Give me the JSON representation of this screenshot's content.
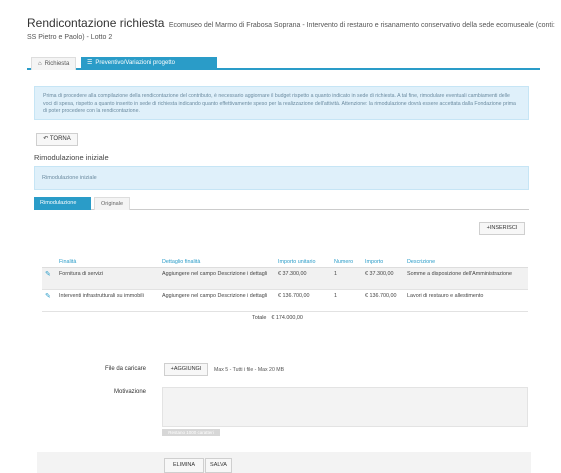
{
  "header": {
    "title": "Rendicontazione richiesta",
    "subtitle": "Ecomuseo del Marmo di Frabosa Soprana - Intervento di restauro e risanamento conservativo della sede ecomuseale (conti:",
    "subtitle_line2": "SS Pietro e Paolo) - Lotto 2"
  },
  "tabs": [
    {
      "label": "Richiesta",
      "icon": "home-icon"
    },
    {
      "label": "Preventivo/Variazioni progetto",
      "icon": "list-icon"
    }
  ],
  "info_text": "Prima di procedere alla compilazione della rendicontazione del contributo, è necessario aggiornare il budget rispetto a quanto indicato in sede di richiesta. A tal fine, rimodulare eventuali cambiamenti delle voci di spesa, rispetto a quanto inserito in sede di richiesta indicando quanto effettivamente speso per la realizzazione dell'attività. Attenzione: la rimodulazione dovrà essere accettata dalla Fondazione prima di poter procedere con la rendicontazione.",
  "back_button": "TORNA",
  "section_title": "Rimodulazione iniziale",
  "panel_text": "Rimodulazione iniziale",
  "subtabs": [
    "Rimodulazione",
    "Originale"
  ],
  "insert_button": "INSERISCI",
  "table": {
    "headers": [
      "Finalità",
      "Dettaglio finalità",
      "Importo unitario",
      "Numero",
      "Importo",
      "Descrizione"
    ],
    "rows": [
      {
        "finalita": "Fornitura di servizi",
        "dettaglio": "Aggiungere nel campo Descrizione i dettagli",
        "importo_unitario": "€ 37.300,00",
        "numero": "1",
        "importo": "€ 37.300,00",
        "descrizione": "Somme a disposizione dell'Amministrazione"
      },
      {
        "finalita": "Interventi infrastrutturali su immobili",
        "dettaglio": "Aggiungere nel campo Descrizione i dettagli",
        "importo_unitario": "€ 136.700,00",
        "numero": "1",
        "importo": "€ 136.700,00",
        "descrizione": "Lavori di restauro e allestimento"
      }
    ],
    "total_label": "Totale",
    "total_value": "€ 174.000,00"
  },
  "upload": {
    "label": "File da caricare",
    "button": "AGGIUNGI",
    "hint": "Max 5 - Tutti i file - Max 20 MB"
  },
  "motivation": {
    "label": "Motivazione",
    "value": "",
    "counter": "Restano 1000 caratteri"
  },
  "footer": {
    "delete_button": "ELIMINA",
    "save_button": "SALVA"
  },
  "colors": {
    "accent": "#2a9cc8",
    "info_bg": "#dff0fa"
  }
}
